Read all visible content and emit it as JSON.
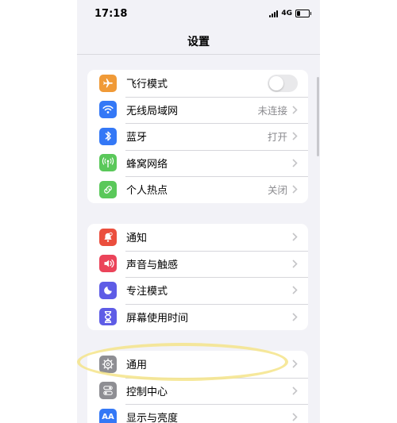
{
  "status": {
    "time": "17:18",
    "network": "4G"
  },
  "header": {
    "title": "设置"
  },
  "groups": {
    "connectivity": {
      "airplane": {
        "label": "飞行模式",
        "icon": "airplane-icon",
        "toggle_on": false,
        "color": "#f09a37"
      },
      "wifi": {
        "label": "无线局域网",
        "value": "未连接",
        "icon": "wifi-icon",
        "color": "#3478f6"
      },
      "bluetooth": {
        "label": "蓝牙",
        "value": "打开",
        "icon": "bluetooth-icon",
        "color": "#3478f6"
      },
      "cellular": {
        "label": "蜂窝网络",
        "icon": "antenna-icon",
        "color": "#5ac85a"
      },
      "hotspot": {
        "label": "个人热点",
        "value": "关闭",
        "icon": "hotspot-icon",
        "color": "#5ac85a"
      }
    },
    "notifications": {
      "notify": {
        "label": "通知",
        "icon": "bell-badge-icon",
        "color": "#eb4e3d"
      },
      "sound": {
        "label": "声音与触感",
        "icon": "speaker-icon",
        "color": "#eb445a"
      },
      "focus": {
        "label": "专注模式",
        "icon": "moon-icon",
        "color": "#5e5ce6"
      },
      "screentime": {
        "label": "屏幕使用时间",
        "icon": "hourglass-icon",
        "color": "#5e5ce6"
      }
    },
    "general": {
      "general": {
        "label": "通用",
        "icon": "gear-icon",
        "color": "#8e8e93"
      },
      "control": {
        "label": "控制中心",
        "icon": "switches-icon",
        "color": "#8e8e93"
      },
      "display": {
        "label": "显示与亮度",
        "icon": "text-size-icon",
        "icon_text": "AA",
        "color": "#3478f6"
      }
    }
  },
  "annotation": {
    "color": "#f4e48a"
  }
}
